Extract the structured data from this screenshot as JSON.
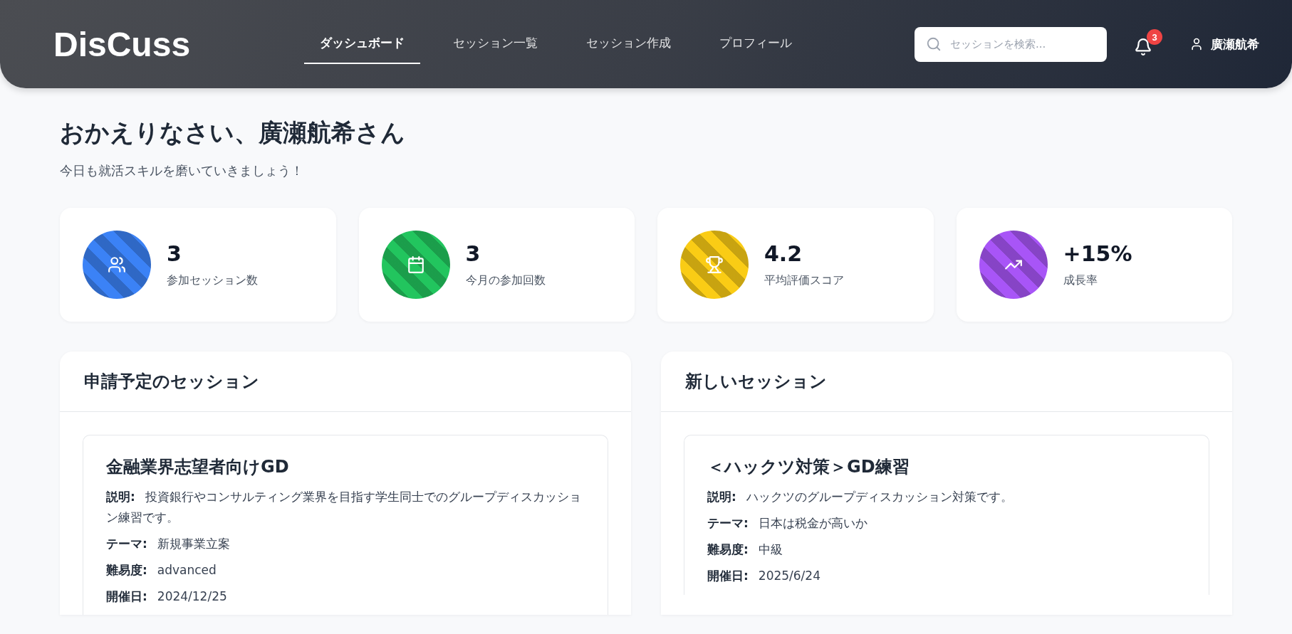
{
  "header": {
    "logo": "DisCuss",
    "nav": [
      {
        "label": "ダッシュボード",
        "selected": true
      },
      {
        "label": "セッション一覧",
        "selected": false
      },
      {
        "label": "セッション作成",
        "selected": false
      },
      {
        "label": "プロフィール",
        "selected": false
      }
    ],
    "search": {
      "placeholder": "セッションを検索..."
    },
    "notification_count": "3",
    "user_name": "廣瀬航希"
  },
  "greeting": {
    "title": "おかえりなさい、廣瀬航希さん",
    "subtitle": "今日も就活スキルを磨いていきましょう！"
  },
  "stats": [
    {
      "kind": "users",
      "value": "3",
      "label": "参加セッション数",
      "color": "#3b82f6"
    },
    {
      "kind": "calendar",
      "value": "3",
      "label": "今月の参加回数",
      "color": "#22c55e"
    },
    {
      "kind": "trophy",
      "value": "4.2",
      "label": "平均評価スコア",
      "color": "#facc15"
    },
    {
      "kind": "trend",
      "value": "+15%",
      "label": "成長率",
      "color": "#a855f7"
    }
  ],
  "panels": [
    {
      "title": "申請予定のセッション",
      "session": {
        "title": "金融業界志望者向けGD",
        "fields": [
          {
            "label": "説明:",
            "value": "投資銀行やコンサルティング業界を目指す学生同士でのグループディスカッション練習です。"
          },
          {
            "label": "テーマ:",
            "value": "新規事業立案"
          },
          {
            "label": "難易度:",
            "value": "advanced"
          },
          {
            "label": "開催日:",
            "value": "2024/12/25"
          }
        ]
      }
    },
    {
      "title": "新しいセッション",
      "session": {
        "title": "＜ハックツ対策＞GD練習",
        "fields": [
          {
            "label": "説明:",
            "value": "ハックツのグループディスカッション対策です。"
          },
          {
            "label": "テーマ:",
            "value": "日本は税金が高いか"
          },
          {
            "label": "難易度:",
            "value": "中級"
          },
          {
            "label": "開催日:",
            "value": "2025/6/24"
          }
        ]
      }
    }
  ]
}
